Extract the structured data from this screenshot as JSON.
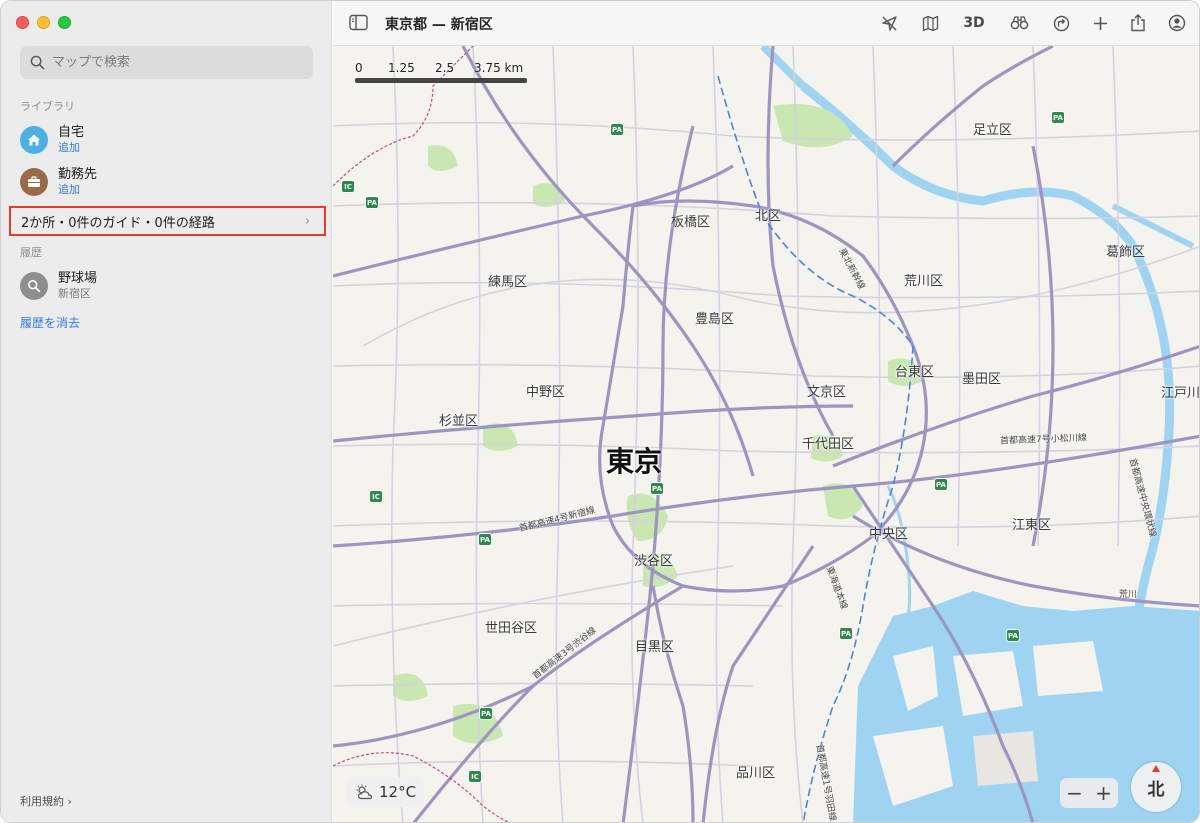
{
  "window": {
    "title": "東京都 — 新宿区"
  },
  "search": {
    "placeholder": "マップで検索"
  },
  "library": {
    "heading": "ライブラリ",
    "items": [
      {
        "title": "自宅",
        "subtitle": "追加",
        "icon": "house-icon",
        "color": "#4ab0e6"
      },
      {
        "title": "勤務先",
        "subtitle": "追加",
        "icon": "briefcase-icon",
        "color": "#9a6a48"
      }
    ],
    "guides_row": "2か所・0件のガイド・0件の経路"
  },
  "history": {
    "heading": "履歴",
    "items": [
      {
        "title": "野球場",
        "subtitle": "新宿区",
        "icon": "magnifier-icon"
      }
    ],
    "clear_label": "履歴を消去"
  },
  "footer": {
    "terms": "利用規約"
  },
  "toolbar": {
    "view_3d": "3D",
    "icons": [
      "location-off-icon",
      "map-mode-icon",
      "binoculars-icon",
      "directions-icon",
      "add-icon",
      "share-icon",
      "account-icon"
    ]
  },
  "map": {
    "city_label": "東京",
    "wards": [
      "足立区",
      "板橋区",
      "北区",
      "葛飾区",
      "練馬区",
      "荒川区",
      "豊島区",
      "台東区",
      "墨田区",
      "中野区",
      "文京区",
      "江戸川区",
      "杉並区",
      "千代田区",
      "中央区",
      "江東区",
      "渋谷区",
      "世田谷区",
      "目黒区",
      "品川区"
    ],
    "roads": [
      "首都高速7号小松川線",
      "首都高速4号新宿線",
      "首都高速3号渋谷線",
      "首都高速中央環状線",
      "東北新幹線",
      "東海道本線",
      "首都高速1号羽田線",
      "荒川"
    ],
    "badges": {
      "parking": "PA",
      "interchange": "IC"
    },
    "scale": {
      "labels": [
        "0",
        "1.25",
        "2.5",
        "3.75 km"
      ]
    },
    "weather": {
      "temperature": "12°C"
    },
    "zoom": {
      "minus": "−",
      "plus": "+"
    },
    "compass": {
      "label": "北"
    },
    "colors": {
      "land": "#f5f3ee",
      "water": "#9ed4f2",
      "park": "#c9e7b0",
      "major_road": "#9d94c4",
      "minor_road": "#d4d2e0"
    }
  }
}
